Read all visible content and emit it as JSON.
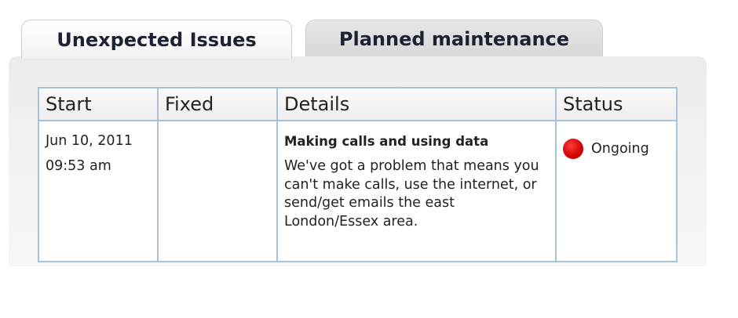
{
  "tabs": [
    {
      "label": "Unexpected Issues",
      "active": true
    },
    {
      "label": "Planned maintenance",
      "active": false
    }
  ],
  "table": {
    "headers": {
      "start": "Start",
      "fixed": "Fixed",
      "details": "Details",
      "status": "Status"
    },
    "rows": [
      {
        "start_date": "Jun 10, 2011",
        "start_time": "09:53 am",
        "fixed": "",
        "details_title": "Making calls and using data",
        "details_body": "We've got a problem that means you can't make calls, use the internet, or send/get emails the east London/Essex area.",
        "status_text": "Ongoing",
        "status_icon": "red-dot-icon",
        "status_color": "#e00000"
      }
    ]
  }
}
